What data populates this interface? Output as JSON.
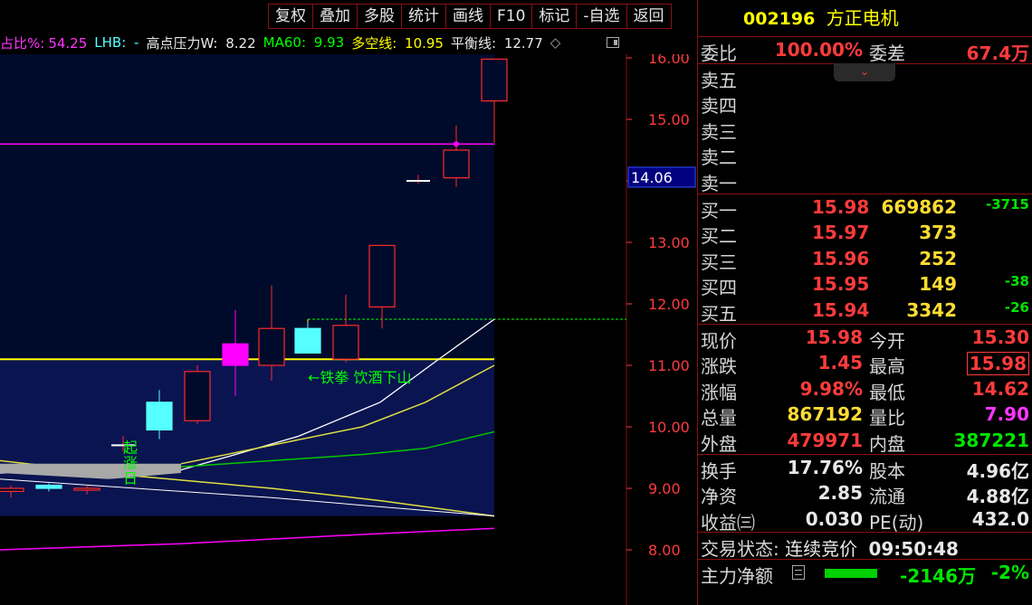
{
  "toolbar": [
    "复权",
    "叠加",
    "多股",
    "统计",
    "画线",
    "F10",
    "标记",
    "-自选",
    "返回"
  ],
  "indicators": {
    "ratio_label": "占比%:",
    "ratio_value": "54.25",
    "lhb_label": "LHB:",
    "lhb_value": "-",
    "high_label": "高点压力W:",
    "high_value": "8.22",
    "ma60_label": "MA60:",
    "ma60_value": "9.93",
    "ls_label": "多空线:",
    "ls_value": "10.95",
    "bal_label": "平衡线:",
    "bal_value": "12.77",
    "diamond": "◇"
  },
  "chart": {
    "price_labels": [
      "16.00",
      "15.00",
      "14.00",
      "13.00",
      "12.00",
      "11.00",
      "10.00",
      "9.00",
      "8.00"
    ],
    "current_price_tag": "14.06",
    "annotation": "←铁拳 饮酒下山",
    "start_label": [
      "起",
      "涨",
      "日"
    ],
    "colors": {
      "bg_band": "#0a1450",
      "up": "#ff2b2b",
      "cyan": "#55ffff",
      "magenta": "#ff00ff",
      "yellow": "#ffff00"
    }
  },
  "chart_data": {
    "type": "candlestick",
    "ylim": [
      7.6,
      16.4
    ],
    "candles": [
      {
        "o": 8.95,
        "h": 9.05,
        "l": 8.85,
        "c": 9.0
      },
      {
        "o": 9.0,
        "h": 9.08,
        "l": 8.95,
        "c": 9.05
      },
      {
        "o": 8.97,
        "h": 9.05,
        "l": 8.9,
        "c": 9.0
      },
      {
        "o": 9.7,
        "h": 9.85,
        "l": 9.6,
        "c": 9.75
      },
      {
        "o": 9.95,
        "h": 10.6,
        "l": 9.8,
        "c": 10.4
      },
      {
        "o": 10.1,
        "h": 11.0,
        "l": 10.05,
        "c": 10.9
      },
      {
        "o": 11.0,
        "h": 11.9,
        "l": 10.5,
        "c": 11.35
      },
      {
        "o": 11.0,
        "h": 12.3,
        "l": 10.75,
        "c": 11.6
      },
      {
        "o": 11.2,
        "h": 11.7,
        "l": 11.2,
        "c": 11.6
      },
      {
        "o": 11.1,
        "h": 12.15,
        "l": 11.05,
        "c": 11.65
      },
      {
        "o": 11.95,
        "h": 12.2,
        "l": 11.6,
        "c": 12.95
      },
      {
        "o": 14.0,
        "h": 14.1,
        "l": 13.95,
        "c": 14.05
      },
      {
        "o": 14.05,
        "h": 14.9,
        "l": 13.9,
        "c": 14.5
      },
      {
        "o": 15.3,
        "h": 15.98,
        "l": 14.62,
        "c": 15.98
      }
    ],
    "hlines": [
      11.1,
      14.6,
      11.75
    ],
    "xlabel": "",
    "ylabel": ""
  },
  "stock": {
    "code": "002196",
    "name": "方正电机"
  },
  "ratio": {
    "wb_label": "委比",
    "wb_value": "100.00%",
    "wc_label": "委差",
    "wc_value": "67.4万"
  },
  "dropdown": "⌄",
  "sells": [
    "卖五",
    "卖四",
    "卖三",
    "卖二",
    "卖一"
  ],
  "buys": [
    {
      "label": "买一",
      "price": "15.98",
      "vol": "669862",
      "chg": "-3715"
    },
    {
      "label": "买二",
      "price": "15.97",
      "vol": "373",
      "chg": ""
    },
    {
      "label": "买三",
      "price": "15.96",
      "vol": "252",
      "chg": ""
    },
    {
      "label": "买四",
      "price": "15.95",
      "vol": "149",
      "chg": "-38"
    },
    {
      "label": "买五",
      "price": "15.94",
      "vol": "3342",
      "chg": "-26"
    }
  ],
  "quote": {
    "now_l": "现价",
    "now_v": "15.98",
    "open_l": "今开",
    "open_v": "15.30",
    "chg_l": "涨跌",
    "chg_v": "1.45",
    "high_l": "最高",
    "high_v": "15.98",
    "pct_l": "涨幅",
    "pct_v": "9.98%",
    "low_l": "最低",
    "low_v": "14.62",
    "vol_l": "总量",
    "vol_v": "867192",
    "lb_l": "量比",
    "lb_v": "7.90",
    "out_l": "外盘",
    "out_v": "479971",
    "in_l": "内盘",
    "in_v": "387221"
  },
  "fund": {
    "hs_l": "换手",
    "hs_v": "17.76%",
    "gb_l": "股本",
    "gb_v": "4.96亿",
    "jz_l": "净资",
    "jz_v": "2.85",
    "lt_l": "流通",
    "lt_v": "4.88亿",
    "sy_l": "收益㈢",
    "sy_v": "0.030",
    "pe_l": "PE(动)",
    "pe_v": "432.0"
  },
  "status": {
    "label": "交易状态:",
    "state": "连续竞价",
    "time": "09:50:48"
  },
  "flow": {
    "label": "主力净额",
    "value": "-2146万",
    "pct": "-2%"
  }
}
